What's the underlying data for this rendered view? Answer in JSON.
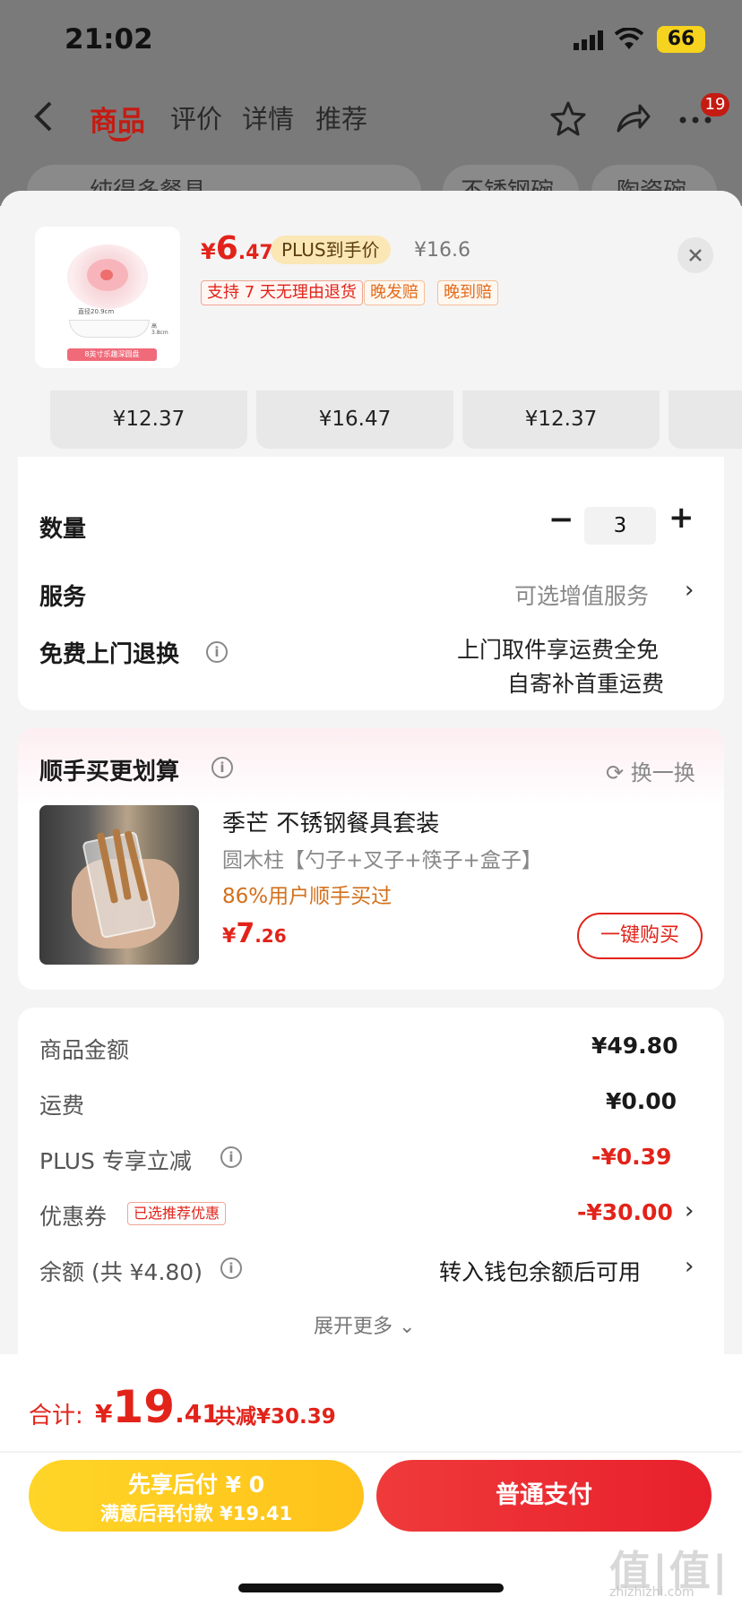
{
  "status": {
    "time": "21:02",
    "battery": "66"
  },
  "nav": {
    "tabs": [
      "商品",
      "评价",
      "详情",
      "推荐"
    ],
    "badge": "19"
  },
  "search": {
    "chips": [
      "纯得多餐具",
      "不锈钢碗",
      "陶瓷碗"
    ]
  },
  "product": {
    "thumb_size": "直径20.9cm",
    "thumb_height": "高 3.8cm",
    "thumb_banner": "8英寸乐趣深圆盘",
    "price_yen": "¥",
    "price_int": "6",
    "price_dec": ".47",
    "plus_label": "PLUS到手价",
    "orig_price": "¥16.6",
    "tags": [
      "支持 7 天无理由退货",
      "晚发赔",
      "晚到赔"
    ]
  },
  "variants": [
    "¥12.37",
    "¥16.47",
    "¥12.37"
  ],
  "options": {
    "quantity_label": "数量",
    "quantity_value": "3",
    "minus": "−",
    "plus": "+",
    "service_label": "服务",
    "service_value": "可选增值服务",
    "return_label": "免费上门退换",
    "return_line1": "上门取件享运费全免",
    "return_line2": "自寄补首重运费"
  },
  "addon": {
    "title": "顺手买更划算",
    "refresh": "换一换",
    "name": "季芒 不锈钢餐具套装",
    "spec": "圆木柱【勺子+叉子+筷子+盒子】",
    "bought": "86%用户顺手买过",
    "price_yen": "¥",
    "price_int": "7",
    "price_dec": ".26",
    "buy_label": "一键购买"
  },
  "summary": {
    "goods_label": "商品金额",
    "goods_value": "¥49.80",
    "shipping_label": "运费",
    "shipping_value": "¥0.00",
    "plus_label": "PLUS 专享立减",
    "plus_value": "-¥0.39",
    "coupon_label": "优惠券",
    "coupon_tag": "已选推荐优惠",
    "coupon_value": "-¥30.00",
    "balance_label": "余额 (共 ¥4.80)",
    "balance_value": "转入钱包余额后可用",
    "expand": "展开更多 ⌄"
  },
  "bottom": {
    "total_label": "合计:",
    "total_yen": "¥",
    "total_int": "19",
    "total_dec": ".41",
    "total_save": "共减¥30.39",
    "later_line1": "先享后付 ¥ 0",
    "later_line2": "满意后再付款 ¥19.41",
    "pay_label": "普通支付",
    "watermark": "值|值|值",
    "watermark_sub": "zhizhizhi.com"
  },
  "colors": {
    "accent": "#e2231a",
    "plus_bg": "#fbe6b6",
    "later_btn": "#ffcb20",
    "pay_btn": "#ea2a30"
  }
}
